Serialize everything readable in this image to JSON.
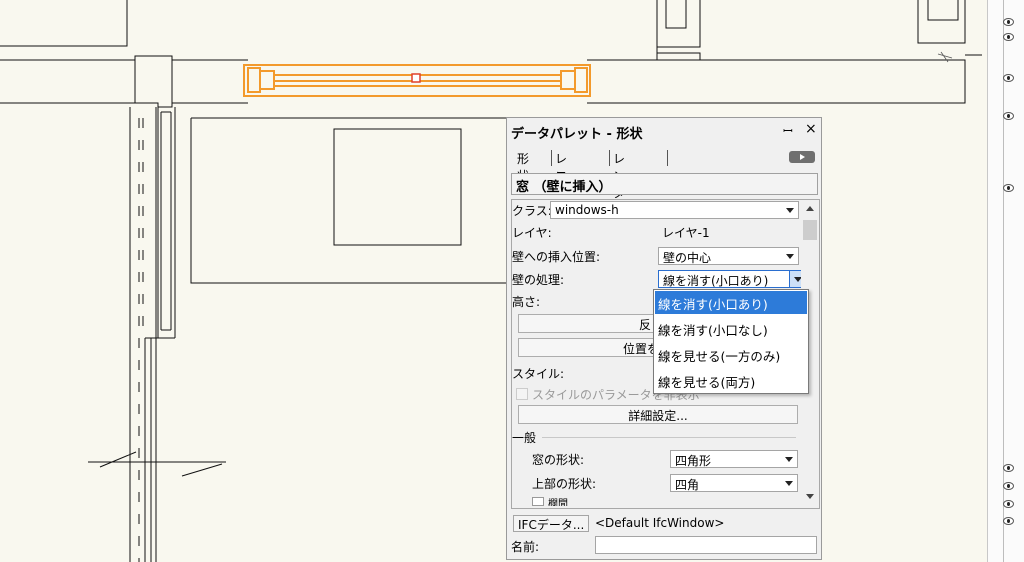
{
  "palette": {
    "title": "データパレット - 形状",
    "pin": "ꟷ",
    "close": "×",
    "tabs": [
      "形状",
      "レコード",
      "レンダー"
    ],
    "object_type": "窓 （壁に挿入）",
    "class_label": "クラス:",
    "class_value": "windows-h",
    "layer_label": "レイヤ:",
    "layer_value": "レイヤ-1",
    "insert_label": "壁への挿入位置:",
    "insert_value": "壁の中心",
    "wall_proc_label": "壁の処理:",
    "wall_proc_value": "線を消す(小口あり)",
    "height_label": "高さ:",
    "flip_button": "反",
    "position_button": "位置を",
    "style_label": "スタイル:",
    "hide_style_params": "スタイルのパラメータを非表示",
    "detail_button": "詳細設定...",
    "general_header": "一般",
    "window_shape_label": "窓の形状:",
    "window_shape_value": "四角形",
    "top_shape_label": "上部の形状:",
    "top_shape_value": "四角",
    "casement_label": "欄間",
    "ifc_button": "IFCデータ...",
    "ifc_value": "<Default IfcWindow>",
    "name_label": "名前:"
  },
  "wall_proc_menu": {
    "options": [
      "線を消す(小口あり)",
      "線を消す(小口なし)",
      "線を見せる(一方のみ)",
      "線を見せる(両方)"
    ],
    "selected_index": 0
  },
  "colors": {
    "selection": "#f39a2c",
    "canvas_bg": "#f9f8ef",
    "menu_highlight": "#2d7bd9"
  }
}
